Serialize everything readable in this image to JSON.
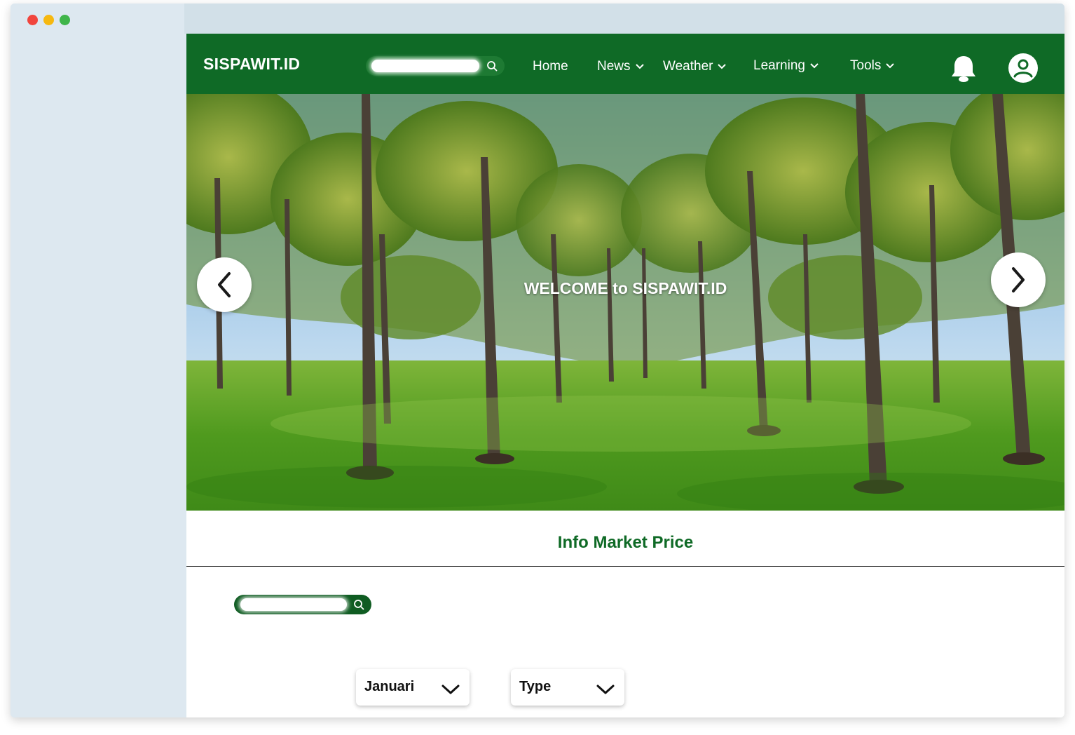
{
  "window": {
    "controls": [
      "close",
      "minimize",
      "maximize"
    ],
    "colors": {
      "close": "#f1453d",
      "minimize": "#f6b80f",
      "maximize": "#3fb54a"
    }
  },
  "navbar": {
    "brand": "SISPAWIT.ID",
    "background": "#0f6a26",
    "search": {
      "value": "",
      "icon": "search-icon"
    },
    "items": [
      {
        "label": "Home",
        "dropdown": false
      },
      {
        "label": "News",
        "dropdown": true
      },
      {
        "label": "Weather",
        "dropdown": true
      },
      {
        "label": "Learning",
        "dropdown": true
      },
      {
        "label": "Tools",
        "dropdown": true
      }
    ],
    "icons": {
      "notifications": "bell-icon",
      "account": "user-icon"
    }
  },
  "hero": {
    "welcome_text": "WELCOME to SISPAWIT.ID",
    "image": "palm-plantation-photo",
    "controls": {
      "prev": "chevron-left-icon",
      "next": "chevron-right-icon"
    }
  },
  "market": {
    "title": "Info Market Price",
    "accent": "#0f6a26",
    "search": {
      "value": "",
      "icon": "search-icon"
    },
    "filters": {
      "month": "Januari",
      "type": "Type"
    }
  }
}
